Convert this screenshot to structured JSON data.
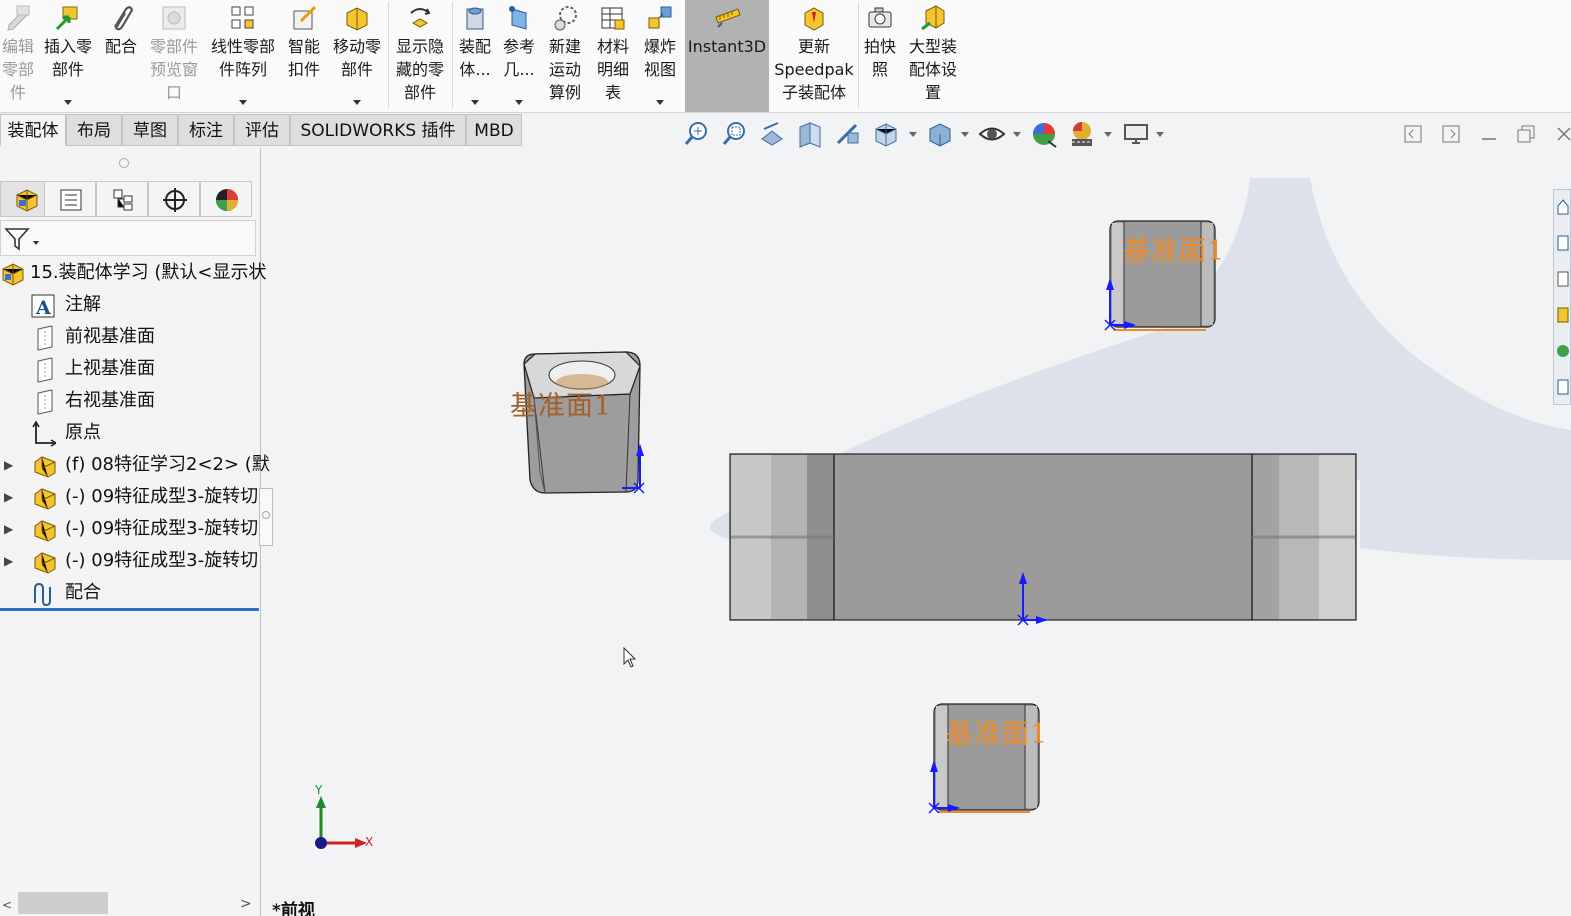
{
  "ribbon": {
    "buttons": [
      {
        "id": "edit-component",
        "label": "编辑\n零部\n件",
        "icon": "edit-component-icon",
        "disabled": true
      },
      {
        "id": "insert-components",
        "label": "插入零\n部件",
        "icon": "insert-components-icon",
        "dropdown": true
      },
      {
        "id": "mate",
        "label": "配合",
        "icon": "mate-paperclip-icon"
      },
      {
        "id": "component-preview",
        "label": "零部件\n预览窗\n口",
        "icon": "component-preview-icon",
        "disabled": true
      },
      {
        "id": "linear-pattern",
        "label": "线性零部\n件阵列",
        "icon": "linear-pattern-icon",
        "dropdown": true
      },
      {
        "id": "smart-fasteners",
        "label": "智能\n扣件",
        "icon": "smart-fasteners-icon"
      },
      {
        "id": "move-component",
        "label": "移动零\n部件",
        "icon": "move-component-icon",
        "dropdown": true
      },
      {
        "id": "show-hidden",
        "label": "显示隐\n藏的零\n部件",
        "icon": "show-hidden-icon"
      },
      {
        "id": "assembly-features",
        "label": "装配\n体...",
        "icon": "assembly-features-icon",
        "dropdown": true
      },
      {
        "id": "reference-geometry",
        "label": "参考\n几...",
        "icon": "reference-geometry-icon",
        "dropdown": true
      },
      {
        "id": "new-motion-study",
        "label": "新建\n运动\n算例",
        "icon": "motion-study-icon"
      },
      {
        "id": "bill-of-materials",
        "label": "材料\n明细\n表",
        "icon": "bom-table-icon"
      },
      {
        "id": "exploded-view",
        "label": "爆炸\n视图",
        "icon": "exploded-view-icon",
        "dropdown": true
      },
      {
        "id": "instant3d",
        "label": "Instant3D",
        "icon": "instant3d-icon",
        "active": true
      },
      {
        "id": "update-speedpak",
        "label": "更新\nSpeedpak\n子装配体",
        "icon": "speedpak-icon"
      },
      {
        "id": "take-snapshot",
        "label": "拍快\n照",
        "icon": "camera-icon"
      },
      {
        "id": "large-assembly-settings",
        "label": "大型装\n配体设\n置",
        "icon": "large-assembly-icon"
      }
    ]
  },
  "tabs": [
    "装配体",
    "布局",
    "草图",
    "标注",
    "评估",
    "SOLIDWORKS 插件",
    "MBD"
  ],
  "active_tab": "装配体",
  "feature_tree": {
    "root": "15.装配体学习 (默认<显示状",
    "items": [
      {
        "label": "注解",
        "icon": "annotations-icon",
        "expandable": false
      },
      {
        "label": "前视基准面",
        "icon": "plane-icon",
        "expandable": false
      },
      {
        "label": "上视基准面",
        "icon": "plane-icon",
        "expandable": false
      },
      {
        "label": "右视基准面",
        "icon": "plane-icon",
        "expandable": false
      },
      {
        "label": "原点",
        "icon": "origin-icon",
        "expandable": false
      },
      {
        "label": "(f) 08特征学习2<2> (默",
        "icon": "part-icon",
        "expandable": true
      },
      {
        "label": "(-) 09特征成型3-旋转切",
        "icon": "part-icon",
        "expandable": true
      },
      {
        "label": "(-) 09特征成型3-旋转切",
        "icon": "part-icon",
        "expandable": true
      },
      {
        "label": "(-) 09特征成型3-旋转切",
        "icon": "part-icon",
        "expandable": true
      },
      {
        "label": "配合",
        "icon": "mates-icon",
        "expandable": false
      }
    ]
  },
  "viewport": {
    "plane_label": "基准面1",
    "view_name": "*前视",
    "triad": {
      "x_label": "X",
      "y_label": "Y"
    }
  },
  "colors": {
    "ribbon_active": "#b2b2b2",
    "annotation": "#f08a24",
    "axis_blue": "#1a1aff",
    "part_gray": "#9b9b9b"
  }
}
